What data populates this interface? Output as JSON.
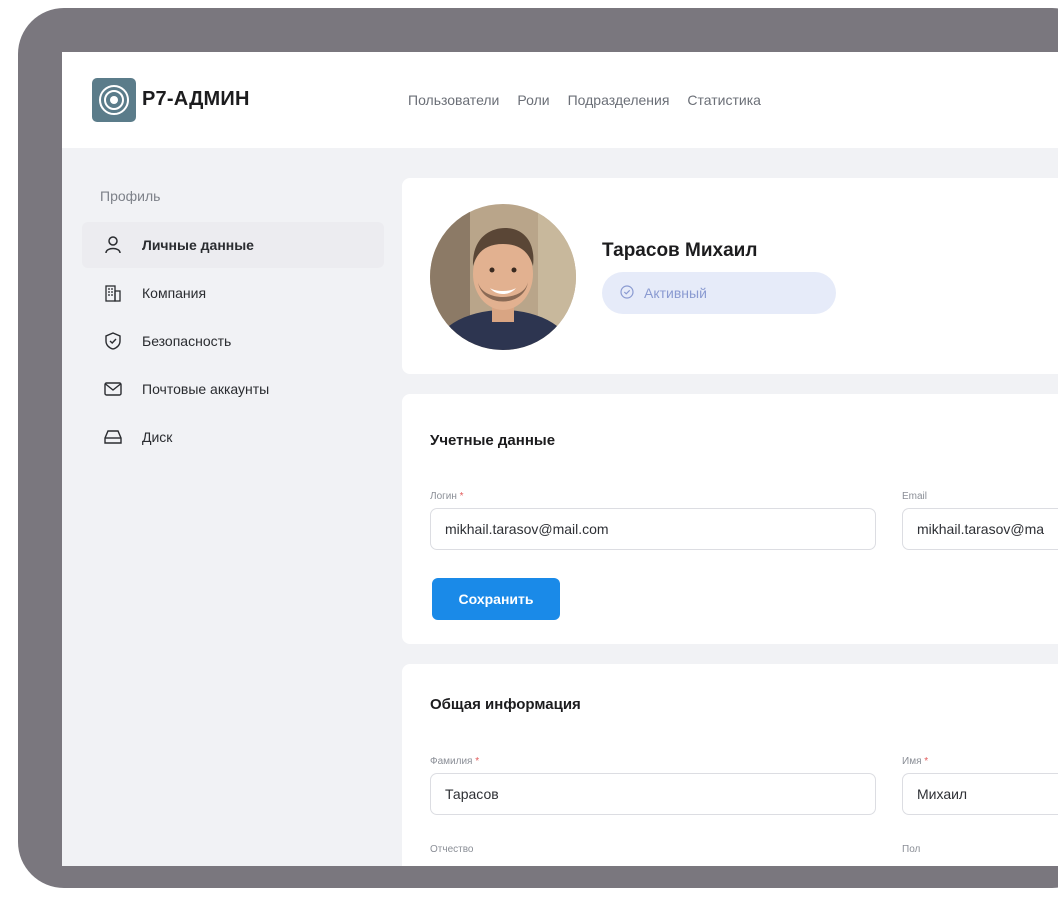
{
  "app": {
    "logo_text": "Р7-АДМИН"
  },
  "nav": {
    "items": [
      {
        "label": "Пользователи"
      },
      {
        "label": "Роли"
      },
      {
        "label": "Подразделения"
      },
      {
        "label": "Статистика"
      }
    ]
  },
  "sidebar": {
    "title": "Профиль",
    "items": [
      {
        "label": "Личные данные",
        "icon": "user-icon",
        "active": true
      },
      {
        "label": "Компания",
        "icon": "building-icon"
      },
      {
        "label": "Безопасность",
        "icon": "shield-icon"
      },
      {
        "label": "Почтовые аккаунты",
        "icon": "mail-icon"
      },
      {
        "label": "Диск",
        "icon": "drive-icon"
      }
    ]
  },
  "profile": {
    "name": "Тарасов Михаил",
    "status": "Активный"
  },
  "credentials": {
    "title": "Учетные данные",
    "login_label": "Логин",
    "login_value": "mikhail.tarasov@mail.com",
    "email_label": "Email",
    "email_value": "mikhail.tarasov@ma",
    "save_label": "Сохранить"
  },
  "general": {
    "title": "Общая информация",
    "lastname_label": "Фамилия",
    "lastname_value": "Тарасов",
    "firstname_label": "Имя",
    "firstname_value": "Михаил",
    "patronymic_label": "Отчество",
    "gender_label": "Пол"
  },
  "colors": {
    "accent": "#1a8ae8",
    "bezel": "#7a777e",
    "status_bg": "#e6ebf9",
    "required": "#e25b5b"
  }
}
